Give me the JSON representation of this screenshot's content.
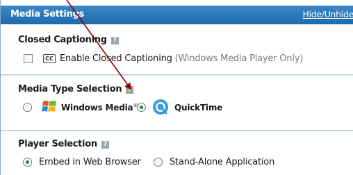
{
  "header": {
    "title": "Media Settings",
    "toggle_link": "Hide/Unhide"
  },
  "closed_captioning": {
    "title": "Closed Captioning",
    "help_icon": "?",
    "cc_icon_text": "CC",
    "checkbox_label": "Enable Closed Captioning",
    "checkbox_note": "(Windows Media Player Only)",
    "checked": false
  },
  "media_type": {
    "title": "Media Type Selection",
    "help_icon": "?",
    "options": [
      {
        "label": "Windows Media",
        "trademark": "®",
        "selected": false
      },
      {
        "label": "QuickTime",
        "selected": true
      }
    ]
  },
  "player": {
    "title": "Player Selection",
    "help_icon": "?",
    "options": [
      {
        "label": "Embed in Web Browser",
        "selected": true
      },
      {
        "label": "Stand-Alone Application",
        "selected": false
      }
    ]
  },
  "colors": {
    "header_bg": "#2a78bb",
    "border": "#b6cde2",
    "radio_selected": "#1f8a3b",
    "arrow": "#8b0000"
  }
}
